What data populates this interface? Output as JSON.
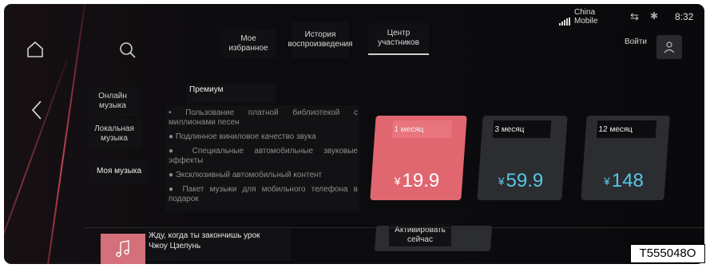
{
  "status": {
    "carrier_line1": "China",
    "carrier_line2": "Mobile",
    "time": "8:32"
  },
  "nav": {
    "home_icon": "home-icon",
    "search_icon": "search-icon",
    "back_icon": "back-icon"
  },
  "tabs": [
    {
      "label": "Мое избранное"
    },
    {
      "label": "История воспроизведения"
    },
    {
      "label": "Центр участников"
    }
  ],
  "login": {
    "label": "Войти"
  },
  "sidebar": {
    "items": [
      {
        "label": "Онлайн музыка"
      },
      {
        "label": "Локальная музыка"
      },
      {
        "label": "Моя музыка"
      }
    ]
  },
  "premium": {
    "title": "Премиум",
    "features": [
      "• Пользование платной библиотекой с миллионами песен",
      "● Подлинное виниловое качество звука",
      "● Специальные автомобильные звуковые эффекты",
      "● Эксклюзивный автомобильный контент",
      "● Пакет музыки для мобильного телефона в подарок"
    ]
  },
  "plans": [
    {
      "period": "1 месяц",
      "currency": "¥",
      "price": "19.9",
      "selected": true
    },
    {
      "period": "3 месяц",
      "currency": "¥",
      "price": "59.9",
      "selected": false
    },
    {
      "period": "12 месяц",
      "currency": "¥",
      "price": "148",
      "selected": false
    }
  ],
  "activate": {
    "label": "Активировать сейчас"
  },
  "now_playing": {
    "title": "Жду, когда ты закончишь урок",
    "artist": "Чжоу Цзелунь"
  },
  "figure_code": "T555048O",
  "colors": {
    "accent_selected": "#e06670",
    "price_text": "#56c8e4",
    "card_bg": "#2b2d31"
  }
}
